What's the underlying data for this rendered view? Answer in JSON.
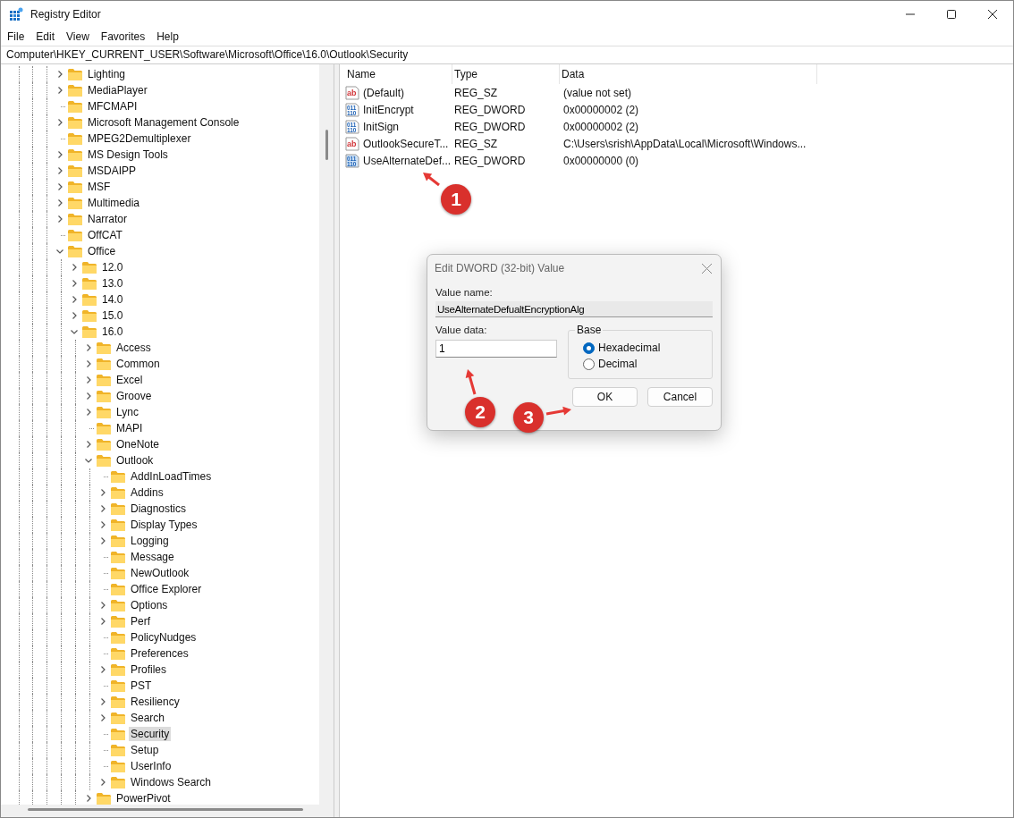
{
  "window": {
    "title": "Registry Editor"
  },
  "menu": [
    "File",
    "Edit",
    "View",
    "Favorites",
    "Help"
  ],
  "address": "Computer\\HKEY_CURRENT_USER\\Software\\Microsoft\\Office\\16.0\\Outlook\\Security",
  "tree": {
    "items": [
      {
        "label": "Lighting",
        "kind": "branch",
        "expanded": false,
        "selected": false
      },
      {
        "label": "MediaPlayer",
        "kind": "branch",
        "expanded": false,
        "selected": false
      },
      {
        "label": "MFCMAPI",
        "kind": "leaf",
        "selected": false
      },
      {
        "label": "Microsoft Management Console",
        "kind": "branch",
        "expanded": false,
        "selected": false
      },
      {
        "label": "MPEG2Demultiplexer",
        "kind": "leaf",
        "selected": false
      },
      {
        "label": "MS Design Tools",
        "kind": "branch",
        "expanded": false,
        "selected": false
      },
      {
        "label": "MSDAIPP",
        "kind": "branch",
        "expanded": false,
        "selected": false
      },
      {
        "label": "MSF",
        "kind": "branch",
        "expanded": false,
        "selected": false
      },
      {
        "label": "Multimedia",
        "kind": "branch",
        "expanded": false,
        "selected": false
      },
      {
        "label": "Narrator",
        "kind": "branch",
        "expanded": false,
        "selected": false
      },
      {
        "label": "OffCAT",
        "kind": "leaf",
        "selected": false
      },
      {
        "label": "Office",
        "kind": "branch",
        "expanded": true,
        "selected": false,
        "children": [
          {
            "label": "12.0",
            "kind": "branch",
            "expanded": false,
            "selected": false
          },
          {
            "label": "13.0",
            "kind": "branch",
            "expanded": false,
            "selected": false
          },
          {
            "label": "14.0",
            "kind": "branch",
            "expanded": false,
            "selected": false
          },
          {
            "label": "15.0",
            "kind": "branch",
            "expanded": false,
            "selected": false
          },
          {
            "label": "16.0",
            "kind": "branch",
            "expanded": true,
            "selected": false,
            "children": [
              {
                "label": "Access",
                "kind": "branch",
                "expanded": false,
                "selected": false
              },
              {
                "label": "Common",
                "kind": "branch",
                "expanded": false,
                "selected": false
              },
              {
                "label": "Excel",
                "kind": "branch",
                "expanded": false,
                "selected": false
              },
              {
                "label": "Groove",
                "kind": "branch",
                "expanded": false,
                "selected": false
              },
              {
                "label": "Lync",
                "kind": "branch",
                "expanded": false,
                "selected": false
              },
              {
                "label": "MAPI",
                "kind": "leaf",
                "selected": false
              },
              {
                "label": "OneNote",
                "kind": "branch",
                "expanded": false,
                "selected": false
              },
              {
                "label": "Outlook",
                "kind": "branch",
                "expanded": true,
                "selected": false,
                "children": [
                  {
                    "label": "AddInLoadTimes",
                    "kind": "leaf",
                    "selected": false
                  },
                  {
                    "label": "Addins",
                    "kind": "branch",
                    "expanded": false,
                    "selected": false
                  },
                  {
                    "label": "Diagnostics",
                    "kind": "branch",
                    "expanded": false,
                    "selected": false
                  },
                  {
                    "label": "Display Types",
                    "kind": "branch",
                    "expanded": false,
                    "selected": false
                  },
                  {
                    "label": "Logging",
                    "kind": "branch",
                    "expanded": false,
                    "selected": false
                  },
                  {
                    "label": "Message",
                    "kind": "leaf",
                    "selected": false
                  },
                  {
                    "label": "NewOutlook",
                    "kind": "leaf",
                    "selected": false
                  },
                  {
                    "label": "Office Explorer",
                    "kind": "leaf",
                    "selected": false
                  },
                  {
                    "label": "Options",
                    "kind": "branch",
                    "expanded": false,
                    "selected": false
                  },
                  {
                    "label": "Perf",
                    "kind": "branch",
                    "expanded": false,
                    "selected": false
                  },
                  {
                    "label": "PolicyNudges",
                    "kind": "leaf",
                    "selected": false
                  },
                  {
                    "label": "Preferences",
                    "kind": "leaf",
                    "selected": false
                  },
                  {
                    "label": "Profiles",
                    "kind": "branch",
                    "expanded": false,
                    "selected": false
                  },
                  {
                    "label": "PST",
                    "kind": "leaf",
                    "selected": false
                  },
                  {
                    "label": "Resiliency",
                    "kind": "branch",
                    "expanded": false,
                    "selected": false
                  },
                  {
                    "label": "Search",
                    "kind": "branch",
                    "expanded": false,
                    "selected": false
                  },
                  {
                    "label": "Security",
                    "kind": "leaf",
                    "selected": true
                  },
                  {
                    "label": "Setup",
                    "kind": "leaf",
                    "selected": false
                  },
                  {
                    "label": "UserInfo",
                    "kind": "leaf",
                    "selected": false
                  },
                  {
                    "label": "Windows Search",
                    "kind": "branch",
                    "expanded": false,
                    "selected": false
                  }
                ]
              },
              {
                "label": "PowerPivot",
                "kind": "branch",
                "expanded": false,
                "selected": false
              }
            ]
          }
        ]
      }
    ]
  },
  "values": {
    "columns": [
      "Name",
      "Type",
      "Data"
    ],
    "rows": [
      {
        "kind": "string",
        "icon_text": [
          "ab"
        ],
        "name": "(Default)",
        "type": "REG_SZ",
        "data": "(value not set)"
      },
      {
        "kind": "binary",
        "icon_text": [
          "011",
          "110"
        ],
        "name": "InitEncrypt",
        "type": "REG_DWORD",
        "data": "0x00000002 (2)"
      },
      {
        "kind": "binary",
        "icon_text": [
          "011",
          "110"
        ],
        "name": "InitSign",
        "type": "REG_DWORD",
        "data": "0x00000002 (2)"
      },
      {
        "kind": "string",
        "icon_text": [
          "ab"
        ],
        "name": "OutlookSecureT...",
        "type": "REG_SZ",
        "data": "C:\\Users\\srish\\AppData\\Local\\Microsoft\\Windows..."
      },
      {
        "kind": "binary",
        "icon_text": [
          "011",
          "110"
        ],
        "name": "UseAlternateDef...",
        "type": "REG_DWORD",
        "data": "0x00000000 (0)"
      }
    ]
  },
  "dialog": {
    "title": "Edit DWORD (32-bit) Value",
    "name_label": "Value name:",
    "name_value": "UseAlternateDefualtEncryptionAlg",
    "data_label": "Value data:",
    "data_value": "1",
    "base_label": "Base",
    "base_options": [
      {
        "label": "Hexadecimal",
        "selected": true
      },
      {
        "label": "Decimal",
        "selected": false
      }
    ],
    "buttons": [
      "OK",
      "Cancel"
    ]
  },
  "annotations": [
    {
      "number": "1"
    },
    {
      "number": "2"
    },
    {
      "number": "3"
    }
  ]
}
